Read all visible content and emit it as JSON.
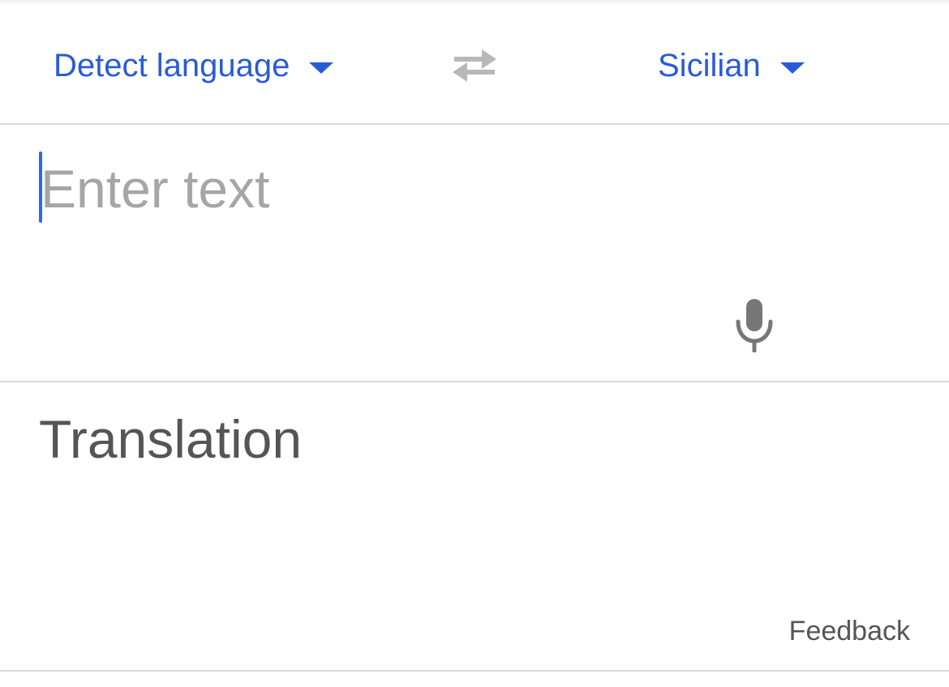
{
  "language_bar": {
    "source_language": "Detect language",
    "target_language": "Sicilian",
    "swap_icon": "swap-arrows-icon"
  },
  "input": {
    "value": "",
    "placeholder": "Enter text",
    "mic_icon": "microphone-icon"
  },
  "output": {
    "placeholder": "Translation",
    "feedback_label": "Feedback"
  },
  "colors": {
    "accent": "#2a5bd7",
    "cursor": "#2a6be4",
    "placeholder": "#a6a6a6",
    "icon_gray": "#777777",
    "divider": "#dcdcdc"
  }
}
